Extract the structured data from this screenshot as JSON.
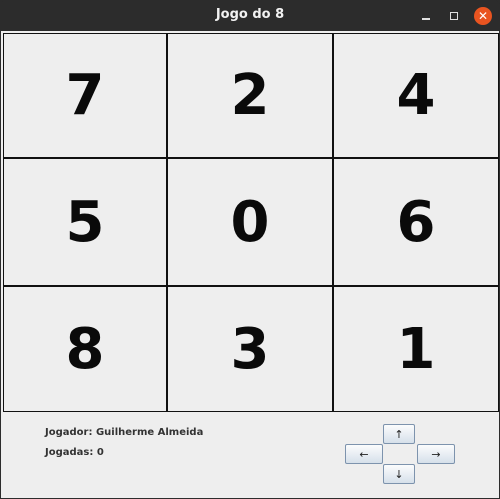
{
  "window": {
    "title": "Jogo do 8"
  },
  "board": {
    "tiles": [
      "7",
      "2",
      "4",
      "5",
      "0",
      "6",
      "8",
      "3",
      "1"
    ]
  },
  "info": {
    "player": "Jogador: Guilherme Almeida",
    "moves": "Jogadas: 0"
  },
  "controls": {
    "up": "↑",
    "left": "←",
    "right": "→",
    "down": "↓"
  },
  "icons": {
    "minimize": "minimize-icon",
    "maximize": "maximize-icon",
    "close": "close-icon"
  },
  "colors": {
    "titlebar": "#2c2c2c",
    "close_button": "#e95420",
    "tile_background": "#eeeeee",
    "tile_text": "#0a0a0a"
  }
}
